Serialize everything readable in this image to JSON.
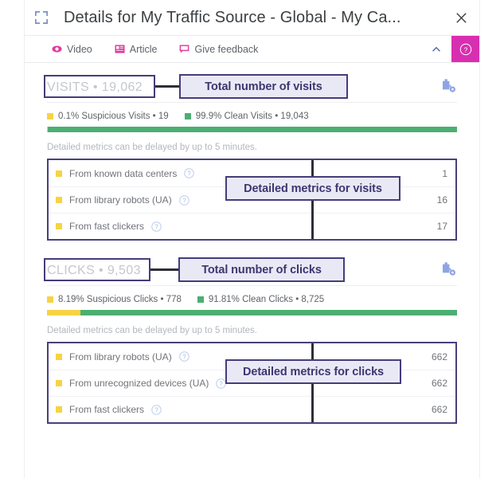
{
  "window": {
    "title": "Details for My Traffic Source - Global - My Ca...",
    "expand_icon": "expand-fullscreen-icon",
    "close_icon": "close-icon"
  },
  "toolbar": {
    "items": [
      {
        "label": "Video",
        "icon": "video-eye-icon"
      },
      {
        "label": "Article",
        "icon": "article-icon"
      },
      {
        "label": "Give feedback",
        "icon": "feedback-icon"
      }
    ],
    "collapse_icon": "chevron-up-icon",
    "help_icon": "help-question-icon",
    "accent_color": "#d82fb0"
  },
  "colors": {
    "suspicious": "#f7d344",
    "clean": "#4caf72",
    "annotation_border": "#463c79",
    "annotation_fill": "#e9e9f6",
    "annotation_text": "#40356f",
    "divider": "#2e2e38"
  },
  "sections": [
    {
      "id": "visits",
      "title": "VISITS • 19,062",
      "copy_icon": "copy-settings-icon",
      "annotation": "Total number of visits",
      "legend": [
        {
          "label": "0.1% Suspicious Visits • 19",
          "color": "#f7d344"
        },
        {
          "label": "99.9% Clean Visits • 19,043",
          "color": "#4caf72"
        }
      ],
      "bar": [
        {
          "color": "#f7d344",
          "percent": 0.1
        },
        {
          "color": "#4caf72",
          "percent": 99.9
        }
      ],
      "note": "Detailed metrics can be delayed by up to 5 minutes.",
      "table_annotation": "Detailed metrics for visits",
      "rows": [
        {
          "label": "From known data centers",
          "value": "1",
          "icon": "info-question-icon",
          "bullet": "#f7d344"
        },
        {
          "label": "From library robots (UA)",
          "value": "16",
          "icon": "info-question-icon",
          "bullet": "#f7d344"
        },
        {
          "label": "From fast clickers",
          "value": "17",
          "icon": "info-question-icon",
          "bullet": "#f7d344"
        }
      ]
    },
    {
      "id": "clicks",
      "title": "CLICKS • 9,503",
      "copy_icon": "copy-settings-icon",
      "annotation": "Total number of clicks",
      "legend": [
        {
          "label": "8.19% Suspicious Clicks • 778",
          "color": "#f7d344"
        },
        {
          "label": "91.81% Clean Clicks • 8,725",
          "color": "#4caf72"
        }
      ],
      "bar": [
        {
          "color": "#f7d344",
          "percent": 8.19
        },
        {
          "color": "#4caf72",
          "percent": 91.81
        }
      ],
      "note": "Detailed metrics can be delayed by up to 5 minutes.",
      "table_annotation": "Detailed metrics for clicks",
      "rows": [
        {
          "label": "From library robots (UA)",
          "value": "662",
          "icon": "info-question-icon",
          "bullet": "#f7d344"
        },
        {
          "label": "From unrecognized devices (UA)",
          "value": "662",
          "icon": "info-question-icon",
          "bullet": "#f7d344"
        },
        {
          "label": "From fast clickers",
          "value": "662",
          "icon": "info-question-icon",
          "bullet": "#f7d344"
        }
      ]
    }
  ]
}
